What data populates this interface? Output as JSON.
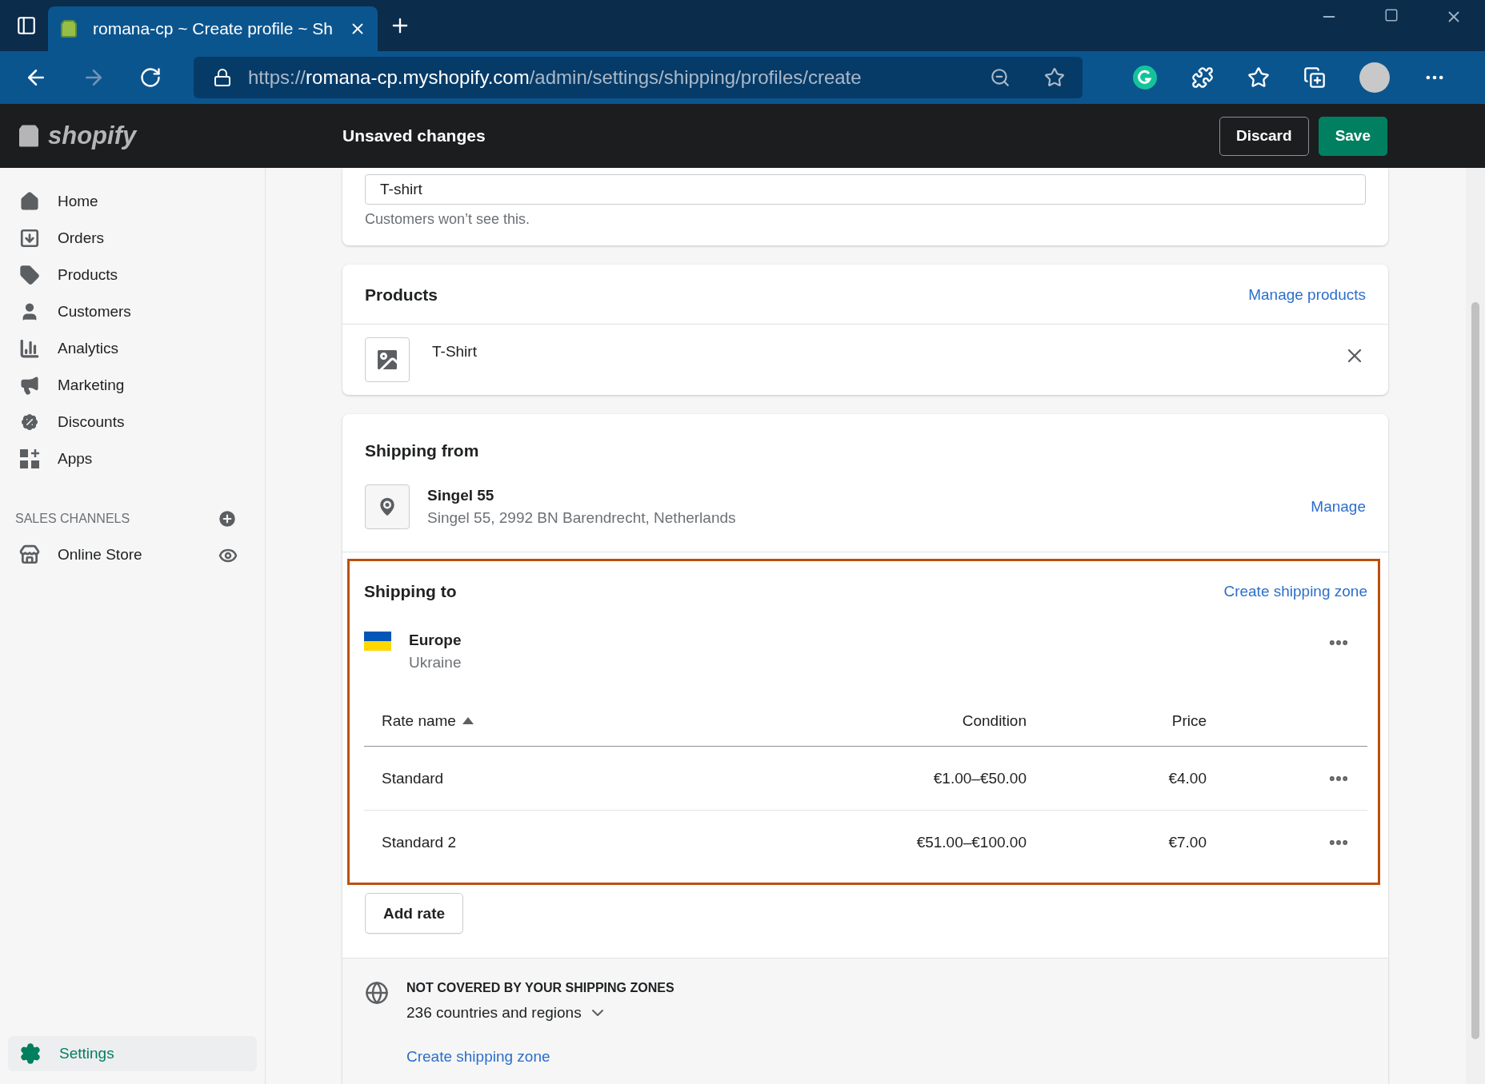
{
  "browser": {
    "tab_title": "romana-cp ~ Create profile ~ Sh",
    "url_prefix": "https://",
    "url_host": "romana-cp.myshopify.com",
    "url_path": "/admin/settings/shipping/profiles/create"
  },
  "topbar": {
    "logo": "shopify",
    "title": "Unsaved changes",
    "buttons": [
      {
        "label": "Discard",
        "kind": "secondary"
      },
      {
        "label": "Save",
        "kind": "primary"
      }
    ]
  },
  "sidebar": {
    "items": [
      {
        "label": "Home",
        "selected": false
      },
      {
        "label": "Orders",
        "selected": false
      },
      {
        "label": "Products",
        "selected": false
      },
      {
        "label": "Customers",
        "selected": false
      },
      {
        "label": "Analytics",
        "selected": false
      },
      {
        "label": "Marketing",
        "selected": false
      },
      {
        "label": "Discounts",
        "selected": false
      },
      {
        "label": "Apps",
        "selected": false
      }
    ],
    "section_title": "SALES CHANNELS",
    "channels": [
      {
        "label": "Online Store",
        "selected": false
      }
    ],
    "settings": {
      "label": "Settings",
      "selected": true
    }
  },
  "name_card": {
    "value": "T-shirt",
    "help": "Customers won’t see this."
  },
  "products_card": {
    "title": "Products",
    "action": "Manage products",
    "items": [
      {
        "name": "T-Shirt"
      }
    ]
  },
  "shipping_from": {
    "title": "Shipping from",
    "location_name": "Singel 55",
    "address": "Singel 55, 2992 BN Barendrecht, Netherlands",
    "action": "Manage"
  },
  "shipping_to": {
    "title": "Shipping to",
    "action": "Create shipping zone",
    "zone": {
      "name": "Europe",
      "countries": "Ukraine"
    },
    "columns": [
      "Rate name",
      "Condition",
      "Price"
    ],
    "rates": [
      {
        "name": "Standard",
        "condition": "€1.00–€50.00",
        "price": "€4.00"
      },
      {
        "name": "Standard 2",
        "condition": "€51.00–€100.00",
        "price": "€7.00"
      }
    ],
    "add_button": "Add rate"
  },
  "not_covered": {
    "title": "NOT COVERED BY YOUR SHIPPING ZONES",
    "summary": "236 countries and regions",
    "link": "Create shipping zone"
  }
}
